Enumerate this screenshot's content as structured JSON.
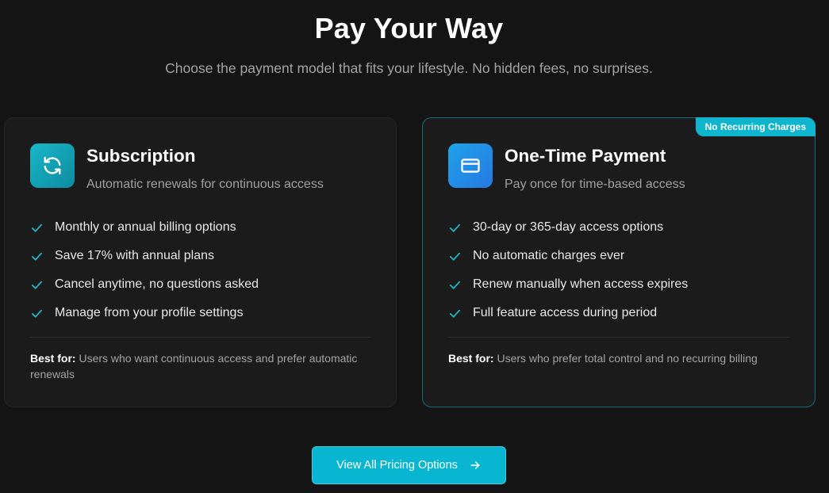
{
  "header": {
    "title": "Pay Your Way",
    "subtitle": "Choose the payment model that fits your lifestyle. No hidden fees, no surprises."
  },
  "cards": [
    {
      "icon": "refresh-icon",
      "title": "Subscription",
      "description": "Automatic renewals for continuous access",
      "features": [
        "Monthly or annual billing options",
        "Save 17% with annual plans",
        "Cancel anytime, no questions asked",
        "Manage from your profile settings"
      ],
      "best_for_label": "Best for:",
      "best_for_text": "Users who want continuous access and prefer automatic renewals"
    },
    {
      "icon": "credit-card-icon",
      "badge": "No Recurring Charges",
      "title": "One-Time Payment",
      "description": "Pay once for time-based access",
      "features": [
        "30-day or 365-day access options",
        "No automatic charges ever",
        "Renew manually when access expires",
        "Full feature access during period"
      ],
      "best_for_label": "Best for:",
      "best_for_text": "Users who prefer total control and no recurring billing"
    }
  ],
  "cta": {
    "label": "View All Pricing Options",
    "icon": "arrow-right-icon"
  },
  "colors": {
    "background": "#141414",
    "accent": "#08b6d2",
    "check": "#1fb8cc"
  }
}
